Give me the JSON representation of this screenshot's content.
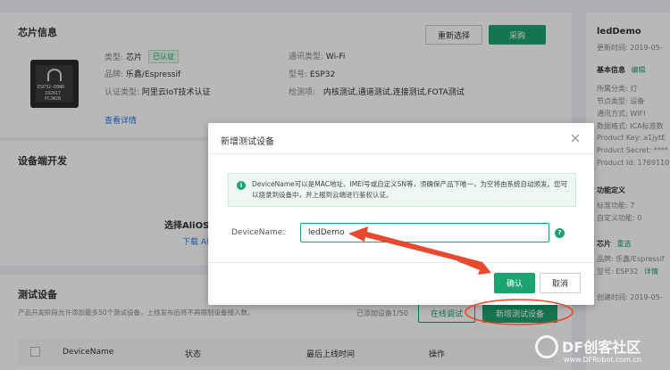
{
  "chip_info": {
    "title": "芯片信息",
    "type_label": "类型:",
    "type_value": "芯片",
    "badge": "已认证",
    "brand_label": "品牌:",
    "brand_value": "乐鑫/Espressif",
    "cert_label": "认证类型:",
    "cert_value": "阿里云IoT技术认证",
    "view_detail": "查看详情",
    "comm_label": "通讯类型:",
    "comm_value": "Wi-Fi",
    "model_label": "型号:",
    "model_value": "ESP32",
    "test_label": "检测项:",
    "test_value": "内核测试,通道测试,连接测试,FOTA测试",
    "reselect_button": "重新选择",
    "purchase_button": "采购",
    "chip_text": [
      "ESP32-D0WD",
      "102017",
      "PCJW28"
    ]
  },
  "device_dev": {
    "title": "设备端开发",
    "select_text": "选择AliOS",
    "download_text": "下载 Al"
  },
  "test_device": {
    "title": "测试设备",
    "desc": "产品开发阶段允许添加最多50个测试设备，上线发布后将不再限制设备接入数。",
    "count": "已添加设备1/50",
    "online_debug_button": "在线调试",
    "add_button": "新增测试设备",
    "columns": [
      "DeviceName",
      "状态",
      "最后上线时间",
      "操作"
    ]
  },
  "sidebar": {
    "product_name": "ledDemo",
    "updated": "更新时间: 2019-05-",
    "basic_info_title": "基本信息",
    "edit": "编辑",
    "rows": [
      "所属分类: 灯",
      "节点类型: 设备",
      "通讯方式: WIFI",
      "数据格式: ICA标准数",
      "Product Key: a1jytE",
      "Product Secret: ****",
      "Product Id: 1769110"
    ],
    "func_title": "功能定义",
    "func_rows": [
      "标准功能: 7",
      "自定义功能: 0"
    ],
    "chip_title": "芯片",
    "reselect": "重选",
    "chip_rows": [
      "品牌: 乐鑫/Espressif",
      "型号: ESP32"
    ],
    "detail": "详情",
    "created": "创建时间: 2019-05-"
  },
  "modal": {
    "title": "新增测试设备",
    "notice": "DeviceName可以是MAC地址、IMEI号或自定义SN等，须确保产品下唯一，为空将由系统自动颁发。您可以烧录到设备中，并上报到云端进行鉴权认证。",
    "field_label": "DeviceName:",
    "field_value": "ledDemo",
    "confirm_button": "确认",
    "cancel_button": "取消"
  },
  "watermark": {
    "brand": "DF创客社区",
    "url": "www.DFRobot.com.cn"
  },
  "colors": {
    "primary": "#1ca36f",
    "link": "#2a7be0",
    "annotation": "#e8482d"
  }
}
